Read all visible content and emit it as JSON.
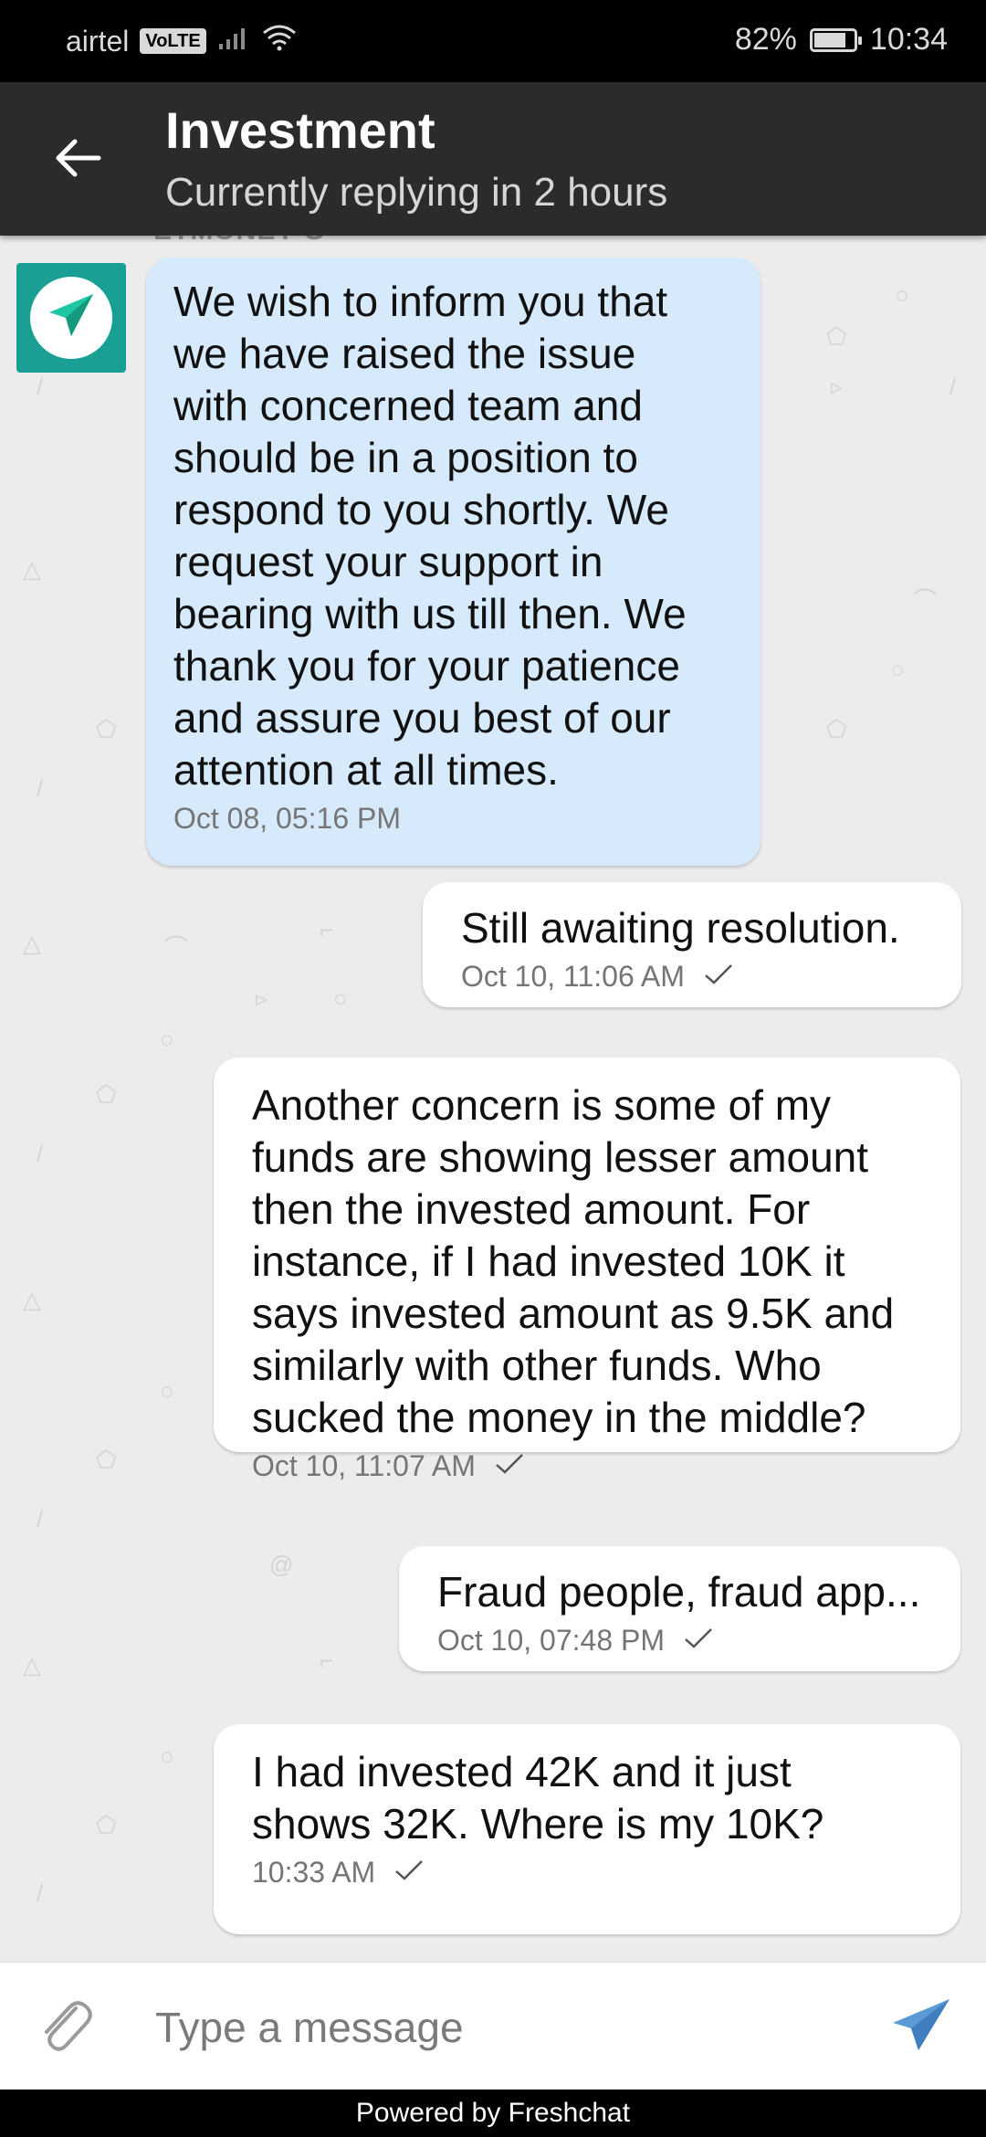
{
  "status_bar": {
    "carrier": "airtel",
    "volte": "VoLTE",
    "battery": "82%",
    "battery_level": 0.82,
    "time": "10:34"
  },
  "header": {
    "title": "Investment",
    "subtitle": "Currently replying in 2 hours"
  },
  "chat": {
    "sender_name_partial": "ETMONEY G",
    "messages": [
      {
        "direction": "incoming",
        "text": "We wish to inform you that\nwe have raised the issue\nwith concerned team and\nshould be in a position to\nrespond to you shortly. We\nrequest your support in\nbearing with us till then. We\nthank you for your patience\nand assure you best of our\nattention at all times.",
        "time": "Oct 08, 05:16 PM"
      },
      {
        "direction": "outgoing",
        "text": "Still awaiting resolution.",
        "time": "Oct 10, 11:06 AM"
      },
      {
        "direction": "outgoing",
        "text": "Another concern is some of my\nfunds are showing lesser amount\nthen the invested amount. For\ninstance, if I had invested 10K it\nsays invested amount as 9.5K and\nsimilarly with other funds. Who\nsucked the money in the middle?",
        "time": "Oct 10, 11:07 AM"
      },
      {
        "direction": "outgoing",
        "text": "Fraud people, fraud app...",
        "time": "Oct 10, 07:48 PM"
      },
      {
        "direction": "outgoing",
        "text": "I had invested 42K and it just\nshows 32K. Where is my 10K?",
        "time": "10:33 AM"
      }
    ]
  },
  "composer": {
    "placeholder": "Type a message"
  },
  "footer": {
    "powered_by": "Powered by Freshchat"
  },
  "colors": {
    "app_bar": "#2b2b2b",
    "incoming_bubble": "#d6eafc",
    "outgoing_bubble": "#ffffff",
    "avatar_bg": "#1a9f94",
    "send_icon": "#5b9bd5"
  }
}
